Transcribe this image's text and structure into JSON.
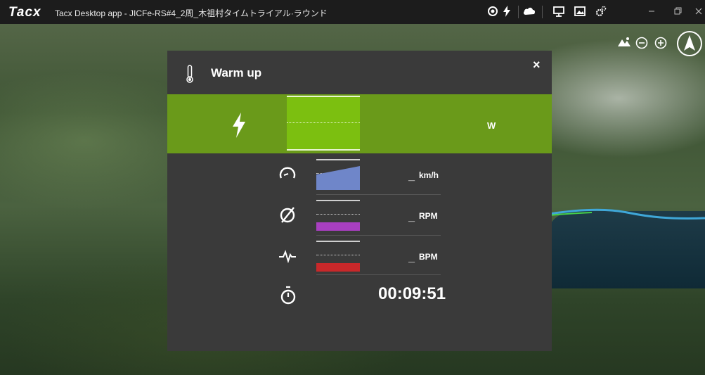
{
  "app": {
    "logo": "Tacx",
    "window_title": "Tacx Desktop app - JICFe-RS#4_2周_木祖村タイムトライアル·ラウンド"
  },
  "titlebar_icons": [
    "sensor-icon",
    "lightning-icon",
    "cloud-icon",
    "screen-icon",
    "image-icon",
    "settings-icon",
    "minimize-icon",
    "restore-icon",
    "close-icon"
  ],
  "map_controls": [
    "terrain-icon",
    "zoom-out-icon",
    "zoom-in-icon",
    "compass-icon"
  ],
  "panel": {
    "title": "Warm up",
    "close_label": "×",
    "power": {
      "value": "",
      "unit": "W"
    },
    "speed": {
      "value": "_",
      "unit": "km/h"
    },
    "cadence": {
      "value": "_",
      "unit": "RPM"
    },
    "heart_rate": {
      "value": "_",
      "unit": "BPM"
    },
    "timer": {
      "value": "00:09:51"
    }
  },
  "colors": {
    "power_band": "#6a9a1a",
    "power_graph": "#7cbf10",
    "speed_fill": "#6f86c9",
    "cadence_fill": "#a83fc0",
    "hr_fill": "#c8282a",
    "panel_bg": "#3a3a3a"
  }
}
